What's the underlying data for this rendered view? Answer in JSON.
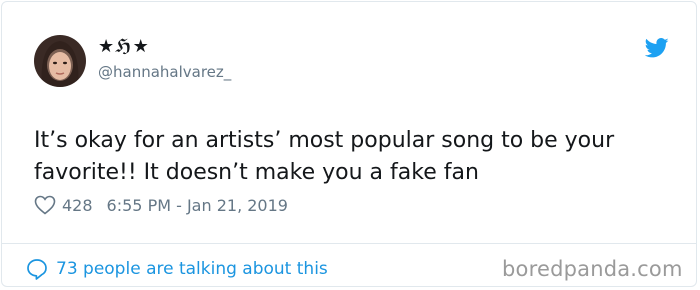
{
  "tweet": {
    "display_name": "★ℌ★",
    "handle": "@hannahalvarez_",
    "text": "It’s okay for an artists’ most popular song to be your favorite!! It doesn’t make you a fake fan",
    "likes": "428",
    "timestamp": "6:55 PM - Jan 21, 2019",
    "talking": "73 people are talking about this"
  },
  "watermark": "boredpanda.com",
  "icons": {
    "bird": "twitter-bird-icon",
    "heart": "heart-icon",
    "bubble": "speech-bubble-icon"
  },
  "colors": {
    "brand_blue": "#1da1f2",
    "link_blue": "#1b95e0",
    "muted": "#657786",
    "text": "#14171a"
  }
}
